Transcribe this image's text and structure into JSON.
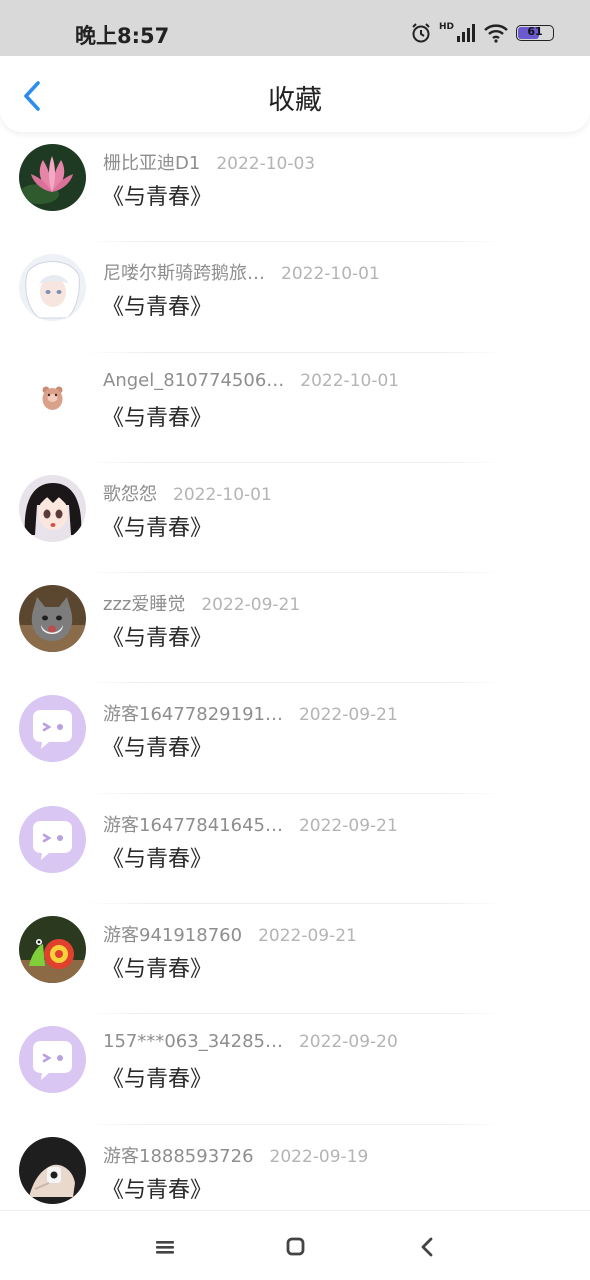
{
  "status_bar": {
    "time": "晚上8:57",
    "network": "HD",
    "battery": "61"
  },
  "header": {
    "title": "收藏"
  },
  "favorites": [
    {
      "name": "栅比亚迪D1",
      "date": "2022-10-03",
      "book": "《与青春》",
      "avatar": "lotus-photo"
    },
    {
      "name": "尼喽尔斯骑跨鹅旅…",
      "date": "2022-10-01",
      "book": "《与青春》",
      "avatar": "anime-white-hair"
    },
    {
      "name": "Angel_810774506…",
      "date": "2022-10-01",
      "book": "《与青春》",
      "avatar": "bear-sticker"
    },
    {
      "name": "歌怨怨",
      "date": "2022-10-01",
      "book": "《与青春》",
      "avatar": "anime-girl"
    },
    {
      "name": "zzz爱睡觉",
      "date": "2022-09-21",
      "book": "《与青春》",
      "avatar": "cat-photo"
    },
    {
      "name": "游客16477829191…",
      "date": "2022-09-21",
      "book": "《与青春》",
      "avatar": "default-chat"
    },
    {
      "name": "游客16477841645…",
      "date": "2022-09-21",
      "book": "《与青春》",
      "avatar": "default-chat"
    },
    {
      "name": "游客941918760",
      "date": "2022-09-21",
      "book": "《与青春》",
      "avatar": "snail-toy"
    },
    {
      "name": "157***063_34285…",
      "date": "2022-09-20",
      "book": "《与青春》",
      "avatar": "default-chat"
    },
    {
      "name": "游客1888593726",
      "date": "2022-09-19",
      "book": "《与青春》",
      "avatar": "hand-photo"
    }
  ],
  "colors": {
    "accent": "#2d8cf0",
    "default_avatar": "#d9c6f2"
  }
}
